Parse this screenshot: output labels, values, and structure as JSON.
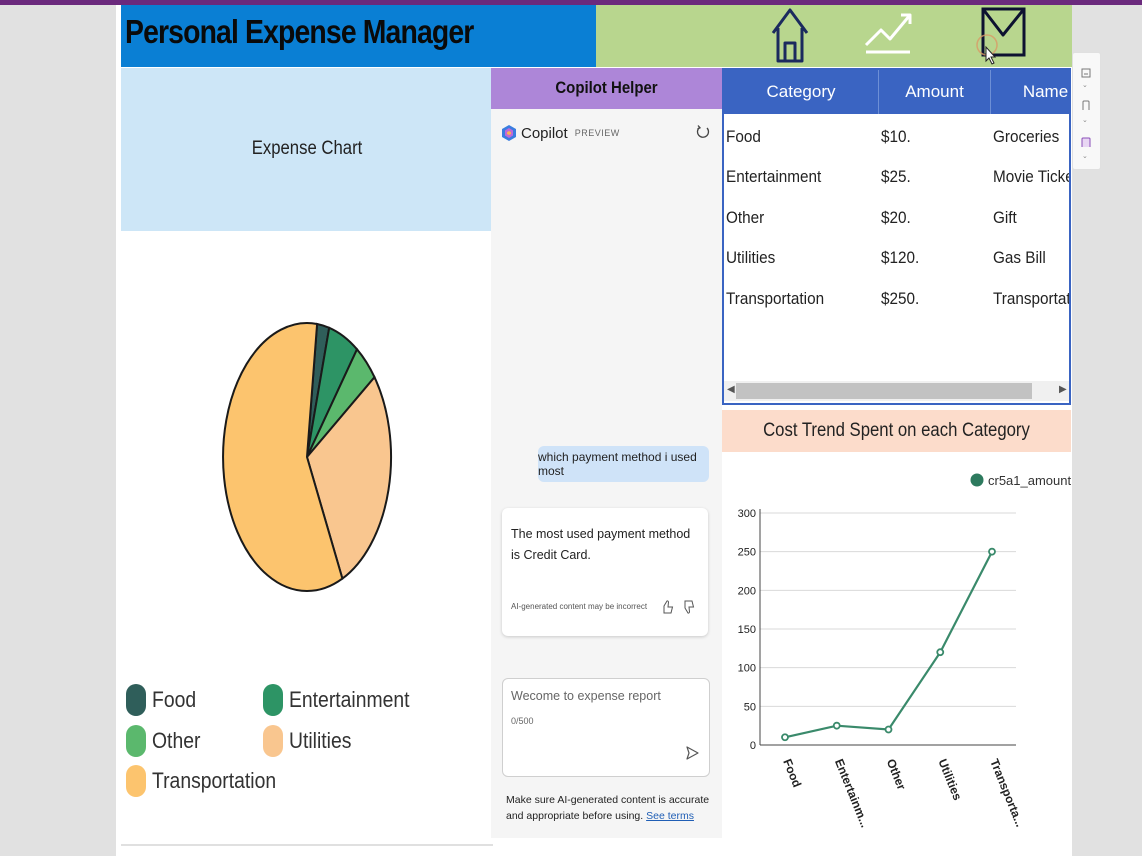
{
  "header": {
    "title": "Personal Expense Manager",
    "nav": [
      {
        "name": "home",
        "icon": "home-icon"
      },
      {
        "name": "trend",
        "icon": "trend-icon"
      },
      {
        "name": "mail",
        "icon": "mail-icon"
      }
    ]
  },
  "expense_chart": {
    "title": "Expense Chart",
    "legend": [
      {
        "label": "Food",
        "color": "#2f5e5a"
      },
      {
        "label": "Entertainment",
        "color": "#2d9465"
      },
      {
        "label": "Other",
        "color": "#5bb86d"
      },
      {
        "label": "Utilities",
        "color": "#f9c68f"
      },
      {
        "label": "Transportation",
        "color": "#fcc46e"
      }
    ]
  },
  "copilot": {
    "panel_title": "Copilot Helper",
    "brand": "Copilot",
    "badge": "PREVIEW",
    "user_message": "which payment method i used most",
    "bot_message": "The most used payment method is Credit Card.",
    "bot_disclaimer": "AI-generated content may be incorrect",
    "input_placeholder": "Wecome to expense report",
    "char_count": "0/500",
    "footer_text": "Make sure AI-generated content is accurate and appropriate before using.",
    "footer_link": "See terms"
  },
  "table": {
    "columns": [
      "Category",
      "Amount",
      "Name"
    ],
    "rows": [
      [
        "Food",
        "$10.",
        "Groceries"
      ],
      [
        "Entertainment",
        "$25.",
        "Movie Ticket"
      ],
      [
        "Other",
        "$20.",
        "Gift"
      ],
      [
        "Utilities",
        "$120.",
        "Gas Bill"
      ],
      [
        "Transportation",
        "$250.",
        "Transportation"
      ]
    ]
  },
  "trend": {
    "title": "Cost Trend Spent on each Category"
  },
  "chart_data": [
    {
      "type": "pie",
      "title": "Expense Chart",
      "categories": [
        "Food",
        "Entertainment",
        "Other",
        "Utilities",
        "Transportation"
      ],
      "values": [
        10,
        25,
        20,
        120,
        250
      ],
      "colors": [
        "#2f5e5a",
        "#2d9465",
        "#5bb86d",
        "#f9c68f",
        "#fcc46e"
      ],
      "legend": "bottom"
    },
    {
      "type": "line",
      "title": "Cost Trend Spent on each Category",
      "categories": [
        "Food",
        "Entertainm...",
        "Other",
        "Utilities",
        "Transporta..."
      ],
      "series": [
        {
          "name": "cr5a1_amount",
          "values": [
            10,
            25,
            20,
            120,
            250
          ],
          "color": "#3a8a6b"
        }
      ],
      "ylim": [
        0,
        300
      ],
      "yticks": [
        0,
        50,
        100,
        150,
        200,
        250,
        300
      ],
      "grid": true,
      "legend": "top-right"
    }
  ]
}
